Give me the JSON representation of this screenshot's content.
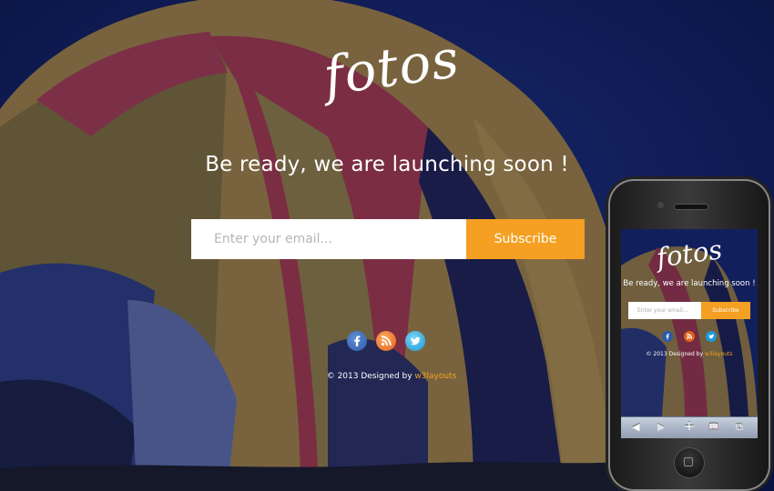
{
  "brand": {
    "logo": "fotos"
  },
  "hero": {
    "tagline": "Be ready, we are launching soon !"
  },
  "subscribe": {
    "placeholder": "Enter your email...",
    "button_label": "Subscribe"
  },
  "social": [
    "facebook-icon",
    "rss-icon",
    "twitter-icon"
  ],
  "footer": {
    "prefix": "© 2013 Designed by ",
    "link": "w3layouts"
  },
  "phone": {
    "logo": "fotos",
    "tagline": "Be ready, we are launching soon !",
    "placeholder": "Enter your email...",
    "button_label": "Subscribe",
    "footer_prefix": "© 2013 Designed by ",
    "footer_link": "w3layouts",
    "toolbar": {
      "back": "◀",
      "forward": "▶",
      "add": "+",
      "bookmarks": "📖",
      "tabs": "⧉"
    }
  },
  "colors": {
    "accent": "#f5a022",
    "background": "#0a1340",
    "facebook": "#2d5aa8",
    "rss": "#e0621a",
    "twitter": "#1d9ad9"
  }
}
